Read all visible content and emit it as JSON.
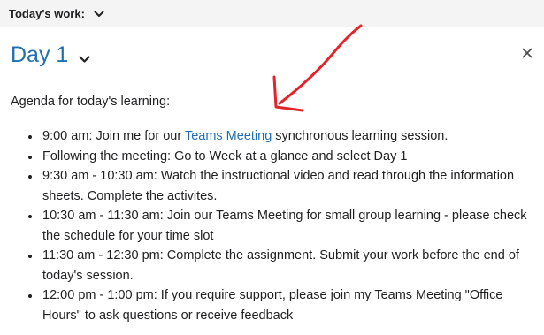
{
  "header": {
    "todays_work_label": "Today's work:"
  },
  "widget": {
    "day_title": "Day 1",
    "agenda_heading": "Agenda for today's learning:",
    "items": [
      {
        "pre": "9:00 am: Join me for our ",
        "link": "Teams Meeting",
        "post": " synchronous learning session."
      },
      {
        "text": "Following the meeting: Go to Week at a glance and select Day 1"
      },
      {
        "text": "9:30 am - 10:30 am: Watch the instructional video and read through the information sheets. Complete the activites."
      },
      {
        "text": "10:30 am - 11:30 am: Join our Teams Meeting for small group learning - please check the schedule for your time slot"
      },
      {
        "text": "11:30 am - 12:30 pm: Complete the assignment. Submit your work before the end of today's session."
      },
      {
        "text": "12:00 pm - 1:00 pm: If you require support, please join my Teams Meeting \"Office Hours\" to ask questions or receive feedback"
      }
    ]
  },
  "colors": {
    "accent": "#1f6fb2",
    "annotation": "#e3242b"
  },
  "icons": {
    "collapse": "chevron-down-icon",
    "close": "close-icon"
  }
}
